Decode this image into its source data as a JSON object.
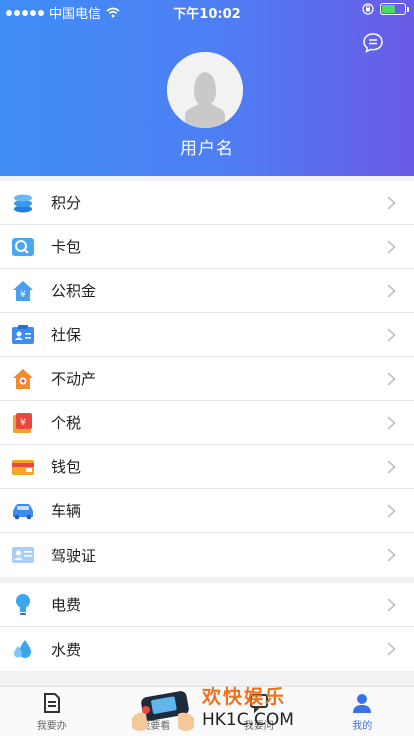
{
  "status": {
    "carrier": "中国电信",
    "time": "下午10:02",
    "battery_level": 0.6
  },
  "header": {
    "username": "用户名",
    "colors": {
      "start": "#3f8ef6",
      "end": "#6a5be6"
    }
  },
  "menu_a": [
    {
      "label": "积分",
      "icon": "coins-icon"
    },
    {
      "label": "卡包",
      "icon": "card-wallet-icon"
    },
    {
      "label": "公积金",
      "icon": "housing-fund-icon"
    },
    {
      "label": "社保",
      "icon": "social-security-icon"
    },
    {
      "label": "不动产",
      "icon": "real-estate-icon"
    },
    {
      "label": "个税",
      "icon": "tax-icon"
    },
    {
      "label": "钱包",
      "icon": "wallet-icon"
    },
    {
      "label": "车辆",
      "icon": "car-icon"
    },
    {
      "label": "驾驶证",
      "icon": "driver-license-icon"
    }
  ],
  "menu_b": [
    {
      "label": "电费",
      "icon": "lightbulb-icon"
    },
    {
      "label": "水费",
      "icon": "water-drop-icon"
    }
  ],
  "tabs": [
    {
      "label": "我要办",
      "icon": "document-icon"
    },
    {
      "label": "我要看",
      "icon": "eye-icon"
    },
    {
      "label": "我要问",
      "icon": "chat-icon"
    },
    {
      "label": "我的",
      "icon": "user-icon",
      "active": true
    }
  ],
  "watermark": {
    "line1": "欢快娱乐",
    "line2": "HK1C.COM"
  }
}
